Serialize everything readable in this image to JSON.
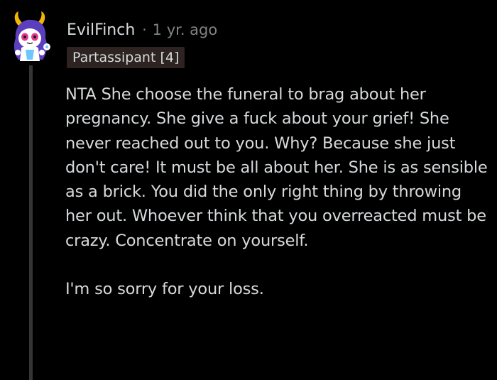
{
  "comment": {
    "username": "EvilFinch",
    "separator": "·",
    "timestamp": "1 yr. ago",
    "flair": "Partassipant [4]",
    "avatar_icon": "snoo-demon-avatar-icon",
    "paragraphs": [
      "NTA She choose the funeral to brag about her pregnancy. She give a fuck about your grief! She never reached out to you. Why? Because she just don't care! It must be all about her. She is as sensible as a brick. You did the only right thing by throwing her out. Whoever think that you overreacted must be crazy. Concentrate on yourself.",
      "I'm so sorry for your loss."
    ]
  },
  "colors": {
    "background": "#000000",
    "text": "#d7dadc",
    "meta": "#818384",
    "thread_line": "#343536",
    "flair_bg": "#2d2320",
    "avatar_purple": "#5b3fbf",
    "avatar_horns": "#f2b705"
  }
}
